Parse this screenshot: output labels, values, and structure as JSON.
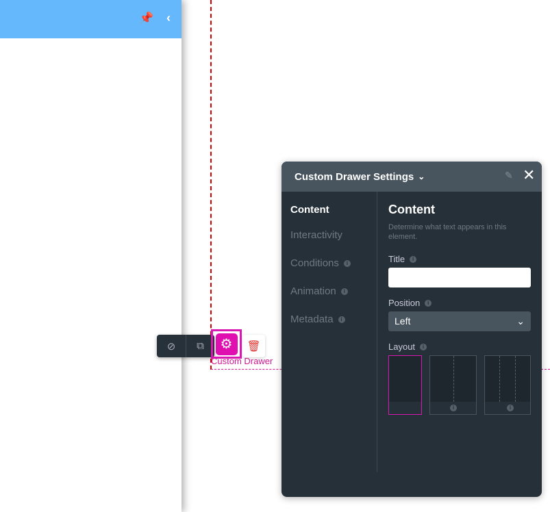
{
  "left_panel": {
    "pin_icon": "pin-icon",
    "collapse_icon": "chevron-left-icon"
  },
  "canvas": {
    "element_label": "Custom Drawer"
  },
  "toolbar": {
    "hide_icon": "eye-slash-icon",
    "open_icon": "external-link-icon",
    "settings_icon": "gear-icon",
    "delete_icon": "trash-icon",
    "accent": "#e010b0"
  },
  "panel": {
    "title": "Custom Drawer Settings",
    "nav": [
      {
        "label": "Content",
        "active": true
      },
      {
        "label": "Interactivity"
      },
      {
        "label": "Conditions",
        "info": true
      },
      {
        "label": "Animation",
        "info": true
      },
      {
        "label": "Metadata",
        "info": true
      }
    ],
    "heading": "Content",
    "description": "Determine what text appears in this element.",
    "title_label": "Title",
    "title_value": "",
    "position_label": "Position",
    "position_value": "Left",
    "layout_label": "Layout",
    "layout_options": [
      "single",
      "two-column",
      "three-column"
    ],
    "layout_selected": 0
  }
}
